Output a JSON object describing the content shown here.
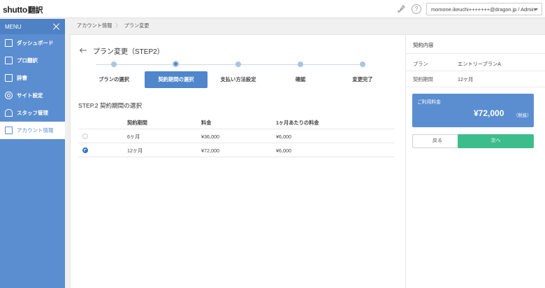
{
  "header": {
    "logo_main": "shutto",
    "logo_sub": "翻訳",
    "help_glyph": "?",
    "user_label": "momone.ikeuchi+++++++@dragon.jp / Admin"
  },
  "sidebar": {
    "menu_label": "MENU",
    "items": [
      {
        "label": "ダッシュボード",
        "icon": "dashboard-icon"
      },
      {
        "label": "プロ翻訳",
        "icon": "pro-translation-icon"
      },
      {
        "label": "辞書",
        "icon": "dictionary-icon"
      },
      {
        "label": "サイト設定",
        "icon": "gear-icon"
      },
      {
        "label": "スタッフ管理",
        "icon": "staff-icon"
      },
      {
        "label": "アカウント情報",
        "icon": "account-icon",
        "active": true
      }
    ]
  },
  "breadcrumb": [
    "アカウント情報",
    "プラン変更"
  ],
  "main": {
    "title": "プラン変更（STEP2）",
    "steps": [
      "プランの選択",
      "契約期間の選択",
      "支払い方法設定",
      "確認",
      "変更完了"
    ],
    "current_step": 2,
    "section_title": "STEP.2 契約期間の選択",
    "table": {
      "headers": [
        "契約期間",
        "料金",
        "1ヶ月あたりの料金"
      ],
      "rows": [
        {
          "period": "6ヶ月",
          "price": "¥36,000",
          "monthly": "¥6,000",
          "selected": false
        },
        {
          "period": "12ヶ月",
          "price": "¥72,000",
          "monthly": "¥6,000",
          "selected": true
        }
      ]
    }
  },
  "panel": {
    "title": "契約内容",
    "plan_label": "プラン",
    "plan_value": "エントリープランA",
    "period_label": "契約期間",
    "period_value": "12ヶ月",
    "fee_label": "ご利用料金",
    "fee_amount": "¥72,000",
    "fee_tax": "（税抜）",
    "back_button": "戻る",
    "next_button": "次へ"
  },
  "colors": {
    "sidebar": "#5b8ed0",
    "accent": "#4f86cc",
    "next_button": "#3dbd8b"
  }
}
